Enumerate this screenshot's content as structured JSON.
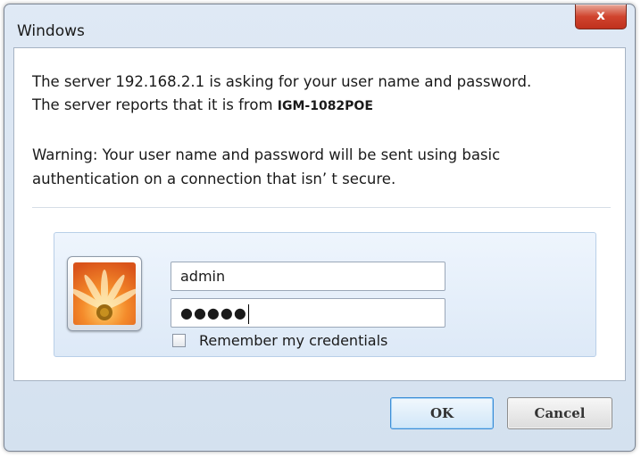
{
  "window": {
    "title": "Windows",
    "close_label": "x"
  },
  "message": {
    "line1": "The server 192.168.2.1 is asking for your user name and password.",
    "line2_prefix": "The server reports that it is from ",
    "line2_realm": "IGM-1082POE",
    "warning_line1": "Warning: Your user name and password will be sent using basic",
    "warning_line2": "authentication on a connection that isn’  t secure."
  },
  "credentials": {
    "username_value": "admin",
    "password_masked": "●●●●●",
    "remember_label": "Remember my credentials",
    "remember_checked": false
  },
  "buttons": {
    "ok_label": "OK",
    "cancel_label": "Cancel"
  },
  "colors": {
    "close_button": "#d0442e",
    "ok_border": "#3c8dd6"
  },
  "icons": {
    "avatar": "flower-avatar-icon",
    "close": "close-icon"
  }
}
